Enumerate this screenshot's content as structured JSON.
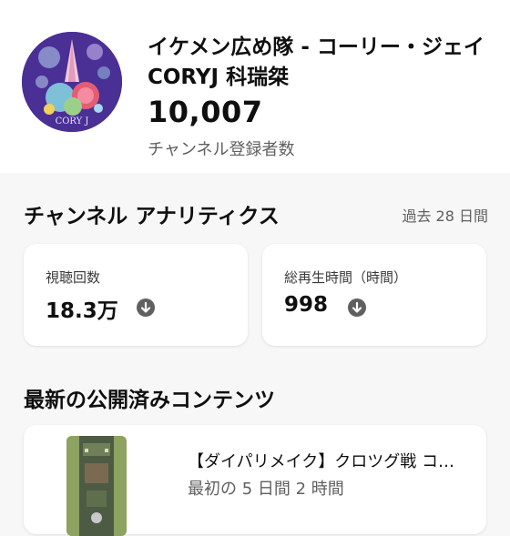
{
  "channel": {
    "name": "イケメン広め隊 - コーリー・ジェイ CORYJ 科瑞桀",
    "subscriber_count": "10,007",
    "subscriber_label": "チャンネル登録者数",
    "avatar_text": "CORY J"
  },
  "analytics": {
    "title": "チャンネル アナリティクス",
    "period": "過去 28 日間",
    "cards": [
      {
        "label": "視聴回数",
        "value": "18.3万",
        "trend_icon": "arrow-down-icon"
      },
      {
        "label": "総再生時間（時間）",
        "value": "998",
        "trend_icon": "arrow-down-icon"
      }
    ]
  },
  "latest": {
    "title": "最新の公開済みコンテンツ",
    "video": {
      "title": "【ダイパリメイク】クロツグ戦 コ…",
      "meta": "最初の 5 日間 2 時間"
    }
  },
  "colors": {
    "background": "#f7f7f7",
    "card": "#ffffff",
    "text": "#0f0f0f",
    "secondary_text": "#606060",
    "avatar_bg": "#4a2f95"
  }
}
